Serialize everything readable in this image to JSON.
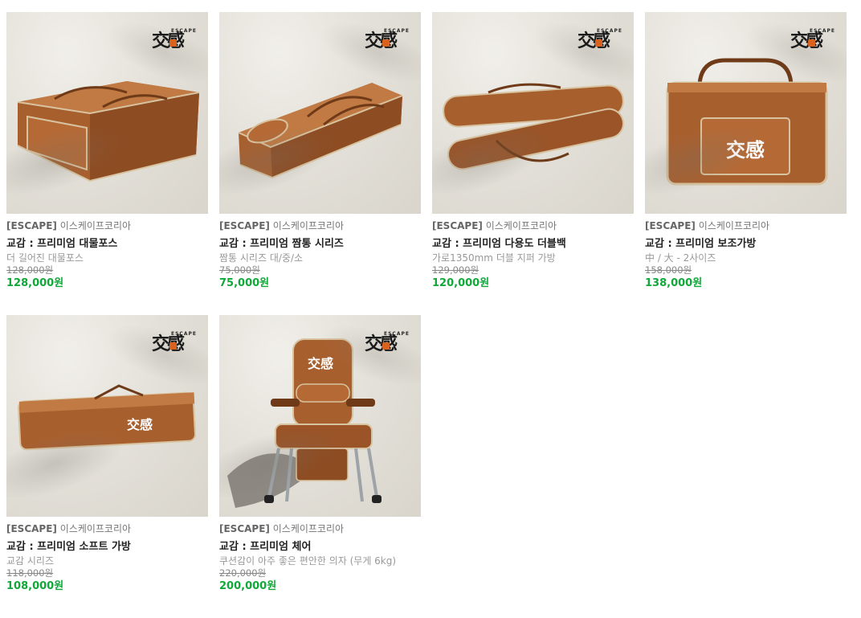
{
  "logo": {
    "glyph": "交感",
    "word": "ESCAPE"
  },
  "products": [
    {
      "brand_tag": "[ESCAPE]",
      "brand_name": "이스케이프코리아",
      "name": "교감 : 프리미엄 대물포스",
      "desc": "더 길어진 대물포스",
      "original_price": "128,000원",
      "price": "128,000원",
      "image": "long-bag"
    },
    {
      "brand_tag": "[ESCAPE]",
      "brand_name": "이스케이프코리아",
      "name": "교감 : 프리미엄 짬통 시리즈",
      "desc": "짬통 시리즈 대/중/소",
      "original_price": "75,000원",
      "price": "75,000원",
      "image": "long-bag"
    },
    {
      "brand_tag": "[ESCAPE]",
      "brand_name": "이스케이프코리아",
      "name": "교감 : 프리미엄 다용도 더블백",
      "desc": "가로1350mm 더블 지퍼 가방",
      "original_price": "129,000원",
      "price": "120,000원",
      "image": "double-bag"
    },
    {
      "brand_tag": "[ESCAPE]",
      "brand_name": "이스케이프코리아",
      "name": "교감 : 프리미엄 보조가방",
      "desc": "中 / 大 - 2사이즈",
      "original_price": "158,000원",
      "price": "138,000원",
      "image": "tote-bag"
    },
    {
      "brand_tag": "[ESCAPE]",
      "brand_name": "이스케이프코리아",
      "name": "교감 : 프리미엄 소프트 가방",
      "desc": "교감 시리즈",
      "original_price": "118,000원",
      "price": "108,000원",
      "image": "soft-bag"
    },
    {
      "brand_tag": "[ESCAPE]",
      "brand_name": "이스케이프코리아",
      "name": "교감 : 프리미엄 체어",
      "desc": "쿠션감이 아주 좋은 편안한 의자 (무게 6kg)",
      "original_price": "220,000원",
      "price": "200,000원",
      "image": "chair"
    }
  ],
  "colors": {
    "price": "#11a83a",
    "leather": "#b36a35",
    "leather_dark": "#7e4420",
    "trim": "#d8c3a0"
  }
}
